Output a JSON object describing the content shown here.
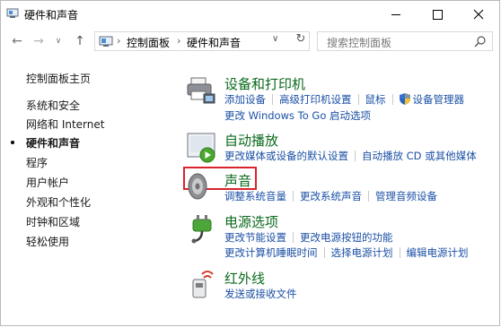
{
  "window": {
    "title": "硬件和声音"
  },
  "nav": {
    "breadcrumbs": [
      "控制面板",
      "硬件和声音"
    ],
    "search_placeholder": "搜索控制面板"
  },
  "sidebar": {
    "home": "控制面板主页",
    "items": [
      {
        "label": "系统和安全"
      },
      {
        "label": "网络和 Internet"
      },
      {
        "label": "硬件和声音",
        "active": true
      },
      {
        "label": "程序"
      },
      {
        "label": "用户帐户"
      },
      {
        "label": "外观和个性化"
      },
      {
        "label": "时钟和区域"
      },
      {
        "label": "轻松使用"
      }
    ]
  },
  "categories": [
    {
      "title": "设备和打印机",
      "icon": "printer-icon",
      "rows": [
        [
          "添加设备",
          "高级打印机设置",
          "鼠标",
          "设备管理器"
        ],
        [
          "更改 Windows To Go 启动选项"
        ]
      ]
    },
    {
      "title": "自动播放",
      "icon": "autoplay-icon",
      "rows": [
        [
          "更改媒体或设备的默认设置",
          "自动播放 CD 或其他媒体"
        ]
      ]
    },
    {
      "title": "声音",
      "icon": "speaker-icon",
      "rows": [
        [
          "调整系统音量",
          "更改系统声音",
          "管理音频设备"
        ]
      ]
    },
    {
      "title": "电源选项",
      "icon": "power-options-icon",
      "rows": [
        [
          "更改节能设置",
          "更改电源按钮的功能"
        ],
        [
          "更改计算机睡眠时间",
          "选择电源计划",
          "编辑电源计划"
        ]
      ]
    },
    {
      "title": "红外线",
      "icon": "infrared-icon",
      "rows": [
        [
          "发送或接收文件"
        ]
      ]
    }
  ],
  "colors": {
    "category_title": "#0b6a1c",
    "link": "#1b50a5",
    "highlight_box": "#d9232d"
  }
}
